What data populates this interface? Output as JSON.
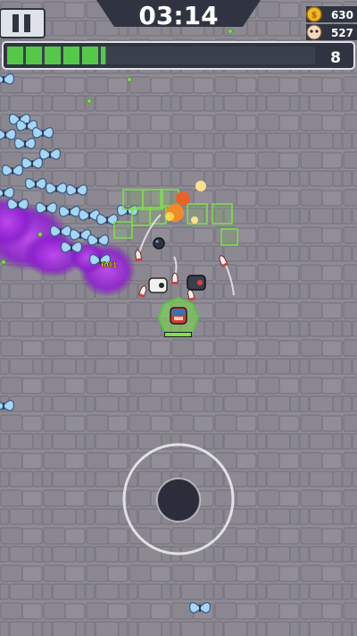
{
  "hud": {
    "timer": "03:14",
    "coins": "630",
    "kills": "527",
    "level": "8",
    "xp_fraction": 0.32,
    "pause_icon": "pause-icon",
    "coin_icon": "gold-coin-icon",
    "kill_icon": "skull-icon"
  },
  "damage_popup": "601",
  "colors": {
    "ground": "#8d8a93",
    "stone_line": "#77747f",
    "xp_fill": "#55c84a",
    "hud_dark": "#2f3440",
    "poison": "#9b2bd8",
    "butterfly": "#9fd0f0",
    "heal_aura": "#6fe04a"
  },
  "joystick": {
    "icon": "virtual-joystick-icon"
  }
}
